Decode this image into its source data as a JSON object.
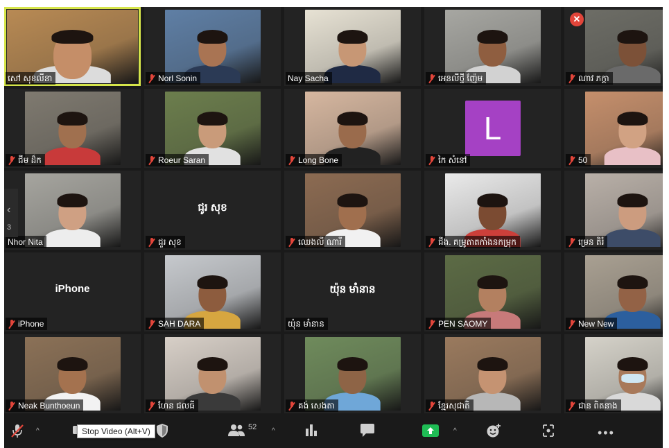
{
  "participants": [
    {
      "name": "សៅ សុខលីនា",
      "muted": false,
      "active": true,
      "type": "video",
      "bg": "#b88a54",
      "skin": "#c58e68",
      "shirt": "#dcdcdc"
    },
    {
      "name": "Norl Sonin",
      "muted": true,
      "type": "video",
      "bg": "#5f7fa5",
      "skin": "#a97453",
      "shirt": "#2b3a55"
    },
    {
      "name": "Nay Sacha",
      "muted": false,
      "type": "video",
      "bg": "#e7e2d4",
      "skin": "#c79775",
      "shirt": "#1f2a44"
    },
    {
      "name": "អេនលីថ្នី ញ៉ែម",
      "muted": true,
      "type": "video",
      "bg": "#a7a7a2",
      "skin": "#8f5e40",
      "shirt": "#d2d2d2"
    },
    {
      "name": "ណាវ ភក្តា",
      "muted": true,
      "type": "video",
      "bg": "#6d6d66",
      "skin": "#7c5138",
      "shirt": "#6a6a6a",
      "close": true
    },
    {
      "name": "ជីម ដ៏ក",
      "muted": true,
      "type": "video",
      "bg": "#7f7a70",
      "skin": "#a0704f",
      "shirt": "#c83a3a"
    },
    {
      "name": "Roeur Saran",
      "muted": true,
      "type": "video",
      "bg": "#6c7e4d",
      "skin": "#c99b7a",
      "shirt": "#e1e1e1"
    },
    {
      "name": "Long Bone",
      "muted": true,
      "type": "video",
      "bg": "#d6b7a0",
      "skin": "#9a6b4c",
      "shirt": "#222222"
    },
    {
      "name": "កៃ សំនៅ",
      "muted": true,
      "type": "avatar",
      "letter": "L"
    },
    {
      "name": "50",
      "muted": true,
      "type": "video",
      "bg": "#c58f6c",
      "skin": "#d1a283",
      "shirt": "#e8c0c6"
    },
    {
      "name": "Nhor Nita",
      "muted": false,
      "type": "video",
      "bg": "#a6a59f",
      "skin": "#cfa083",
      "shirt": "#ededed"
    },
    {
      "name": "ជួរ សុខ",
      "muted": true,
      "type": "name",
      "center": "ជូរ សុខ"
    },
    {
      "name": "ឈេងលី ណារី",
      "muted": true,
      "type": "video",
      "bg": "#8c6b52",
      "skin": "#a06f4e",
      "shirt": "#f1f1f1"
    },
    {
      "name": "ជីង. គម្រូតាតកាំងនកម្រុក",
      "muted": true,
      "type": "video",
      "bg": "#eaeaea",
      "skin": "#7b4b32",
      "shirt": "#cc3f3a"
    },
    {
      "name": "ម្រេន តិរំ",
      "muted": true,
      "type": "video",
      "bg": "#b9b0a8",
      "skin": "#cc9c7f",
      "shirt": "#3d4c68"
    },
    {
      "name": "iPhone",
      "muted": true,
      "type": "name",
      "center": "iPhone"
    },
    {
      "name": "SAH DARA",
      "muted": true,
      "type": "video",
      "bg": "#c6c9cd",
      "skin": "#8d5c3e",
      "shirt": "#d6a640"
    },
    {
      "name": "យ៉ុន មាំនាន",
      "muted": false,
      "type": "name",
      "center": "យ៉ុន មាំនាន"
    },
    {
      "name": "PEN SAOMY",
      "muted": true,
      "type": "video",
      "bg": "#5c6b45",
      "skin": "#b38060",
      "shirt": "#c77a7a"
    },
    {
      "name": "New New",
      "muted": true,
      "type": "video",
      "bg": "#a9a092",
      "skin": "#936246",
      "shirt": "#2c5f9e"
    },
    {
      "name": "Neak Bunthoeun",
      "muted": true,
      "type": "video",
      "bg": "#8b7157",
      "skin": "#a4724f",
      "shirt": "#f2f2f2"
    },
    {
      "name": "ហែន ជលធី",
      "muted": true,
      "type": "video",
      "bg": "#d7cfc7",
      "skin": "#c1916f",
      "shirt": "#3a3a3a"
    },
    {
      "name": "គង់ សេងតា",
      "muted": true,
      "type": "video",
      "bg": "#6f8b5c",
      "skin": "#8e6446",
      "shirt": "#6fa7d8"
    },
    {
      "name": "ខ្មែរសុជាតិ",
      "muted": true,
      "type": "video",
      "bg": "#9a7a5e",
      "skin": "#c59372",
      "shirt": "#b7b7b7"
    },
    {
      "name": "ជាន ពិតនាង",
      "muted": true,
      "type": "video",
      "bg": "#d5d2c9",
      "skin": "#a8795a",
      "shirt": "#d9d9d9",
      "mask": true
    }
  ],
  "toolbar": {
    "tooltip": "Stop Video (Alt+V)",
    "participants_count": "52"
  },
  "colors": {
    "accent": "#d6e54a",
    "mute": "#e2453a",
    "share": "#1fbc55",
    "avatar": "#a541c4"
  }
}
